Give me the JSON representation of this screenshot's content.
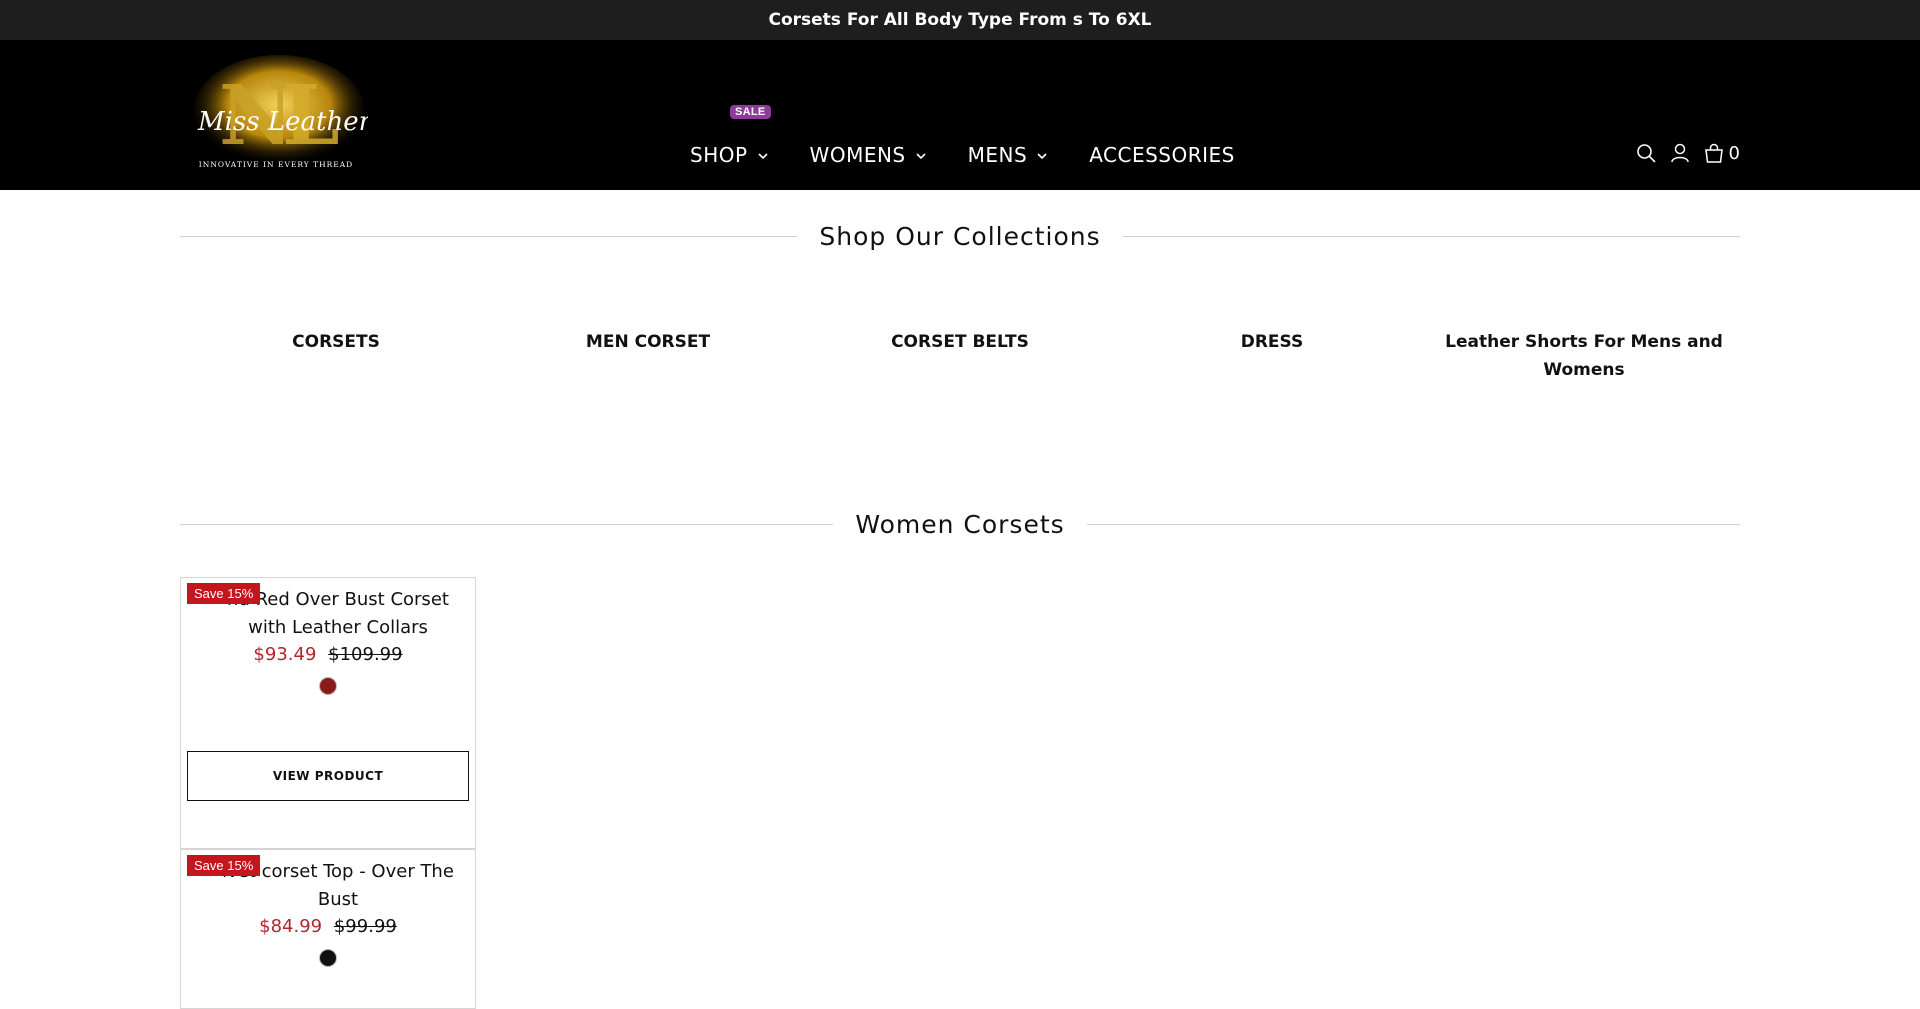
{
  "announcement": {
    "text": "Corsets For All Body Type From s To 6XL"
  },
  "brand": {
    "logo_script": "Miss Leather",
    "logo_tagline": "INNOVATIVE IN EVERY THREAD",
    "colors": {
      "gold": "#c9a227",
      "bg": "#000000"
    }
  },
  "nav": {
    "items": [
      {
        "label": "SHOP",
        "has_dropdown": true,
        "badge": "SALE"
      },
      {
        "label": "WOMENS",
        "has_dropdown": true
      },
      {
        "label": "MENS",
        "has_dropdown": true
      },
      {
        "label": "ACCESSORIES",
        "has_dropdown": false
      }
    ],
    "sale_badge_color": "#8e3b9c"
  },
  "header_icons": {
    "search": "search-icon",
    "account": "user-icon",
    "cart": "bag-icon",
    "cart_count": "0"
  },
  "collections_section": {
    "title": "Shop Our Collections",
    "items": [
      {
        "label": "CORSETS"
      },
      {
        "label": "MEN CORSET"
      },
      {
        "label": "CORSET BELTS"
      },
      {
        "label": "DRESS"
      },
      {
        "label": "Leather Shorts For Mens and Womens"
      }
    ]
  },
  "women_corsets": {
    "title": "Women Corsets",
    "products": [
      {
        "badge": "Save 15%",
        "title": "nd Red Over Bust Corset with Leather Collars",
        "sale_price": "$93.49",
        "original_price": "$109.99",
        "swatch_color": "#8b1a1a",
        "button": "VIEW PRODUCT"
      },
      {
        "badge": "Save 15%",
        "title": "lvet corset Top - Over The Bust",
        "sale_price": "$84.99",
        "original_price": "$99.99",
        "swatch_color": "#111111"
      }
    ]
  }
}
